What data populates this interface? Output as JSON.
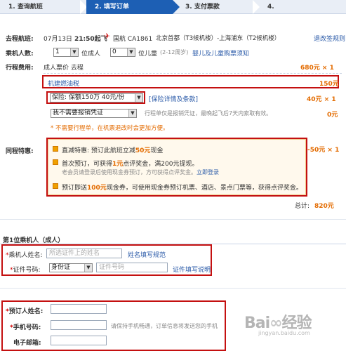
{
  "steps": [
    "1. 查询航班",
    "2. 填写订单",
    "3. 支付票款",
    "4."
  ],
  "flight": {
    "label": "去程航班:",
    "date": "07月13日",
    "time": "21:50起飞",
    "airline": "国航 CA1861",
    "route": "北京首都（T3候机楼）-上海浦东（T2候机楼）",
    "policy_link": "退改签规则"
  },
  "passengers": {
    "label": "乘机人数:",
    "adult_value": "1",
    "adult_unit": "位成人",
    "child_value": "0",
    "child_unit": "位儿童",
    "child_note": "(2-12周岁)",
    "infant_link": "婴儿及儿童购票须知"
  },
  "fees": {
    "label": "行程费用:",
    "fare_label": "成人票价 去程",
    "fare_price": "680元 × 1",
    "tax_label": "机建燃油税",
    "tax_price": "150元",
    "insurance_value": "保险: 保额150万 40元/份",
    "insurance_link": "[保险详情及条款]",
    "insurance_price": "40元 × 1",
    "receipt_value": "我不需要报销凭证",
    "receipt_note": "行程单仅是报销凭证，最晚起飞后7天内索取有效。",
    "receipt_price": "0元",
    "receipt_tip": "* 不需要行程单，在机票退改时会更加方便。"
  },
  "promo": {
    "label": "同程特惠:",
    "price": "-50元 × 1",
    "item1_a": "直减特惠: 预订此航班立减",
    "item1_b": "50元",
    "item1_c": "现金",
    "item2_a": "首次预订，可获得",
    "item2_b": "1元",
    "item2_c": "点评奖金，满200元提现。",
    "item2_sub": "老会员请登录后使用现金券预订，方可获得点评奖金。",
    "item2_link": "立即登录",
    "item3_a": "预订即送",
    "item3_b": "100元",
    "item3_c": "现金券，可使用现金券预订机票、酒店、景点门票等，获得点评奖金。"
  },
  "total": {
    "label": "总计:",
    "value": "820元"
  },
  "passenger1": {
    "title": "第1位乘机人（成人）",
    "name_label": "乘机人姓名:",
    "name_placeholder": "所选证件上的姓名",
    "name_link": "姓名填写规范",
    "id_label": "证件号码:",
    "id_type": "身份证",
    "id_placeholder": "证件号码",
    "id_link": "证件填写说明"
  },
  "contact": {
    "name_label": "预订人姓名:",
    "phone_label": "手机号码:",
    "phone_note": "请保持手机畅通，订单信息将发送您的手机",
    "email_label": "电子邮箱:"
  },
  "watermark": "jingyan.baidu.com",
  "colors": {
    "step_active": "#1d5fb4",
    "highlight_box": "#c41010",
    "price": "#e36b00"
  }
}
